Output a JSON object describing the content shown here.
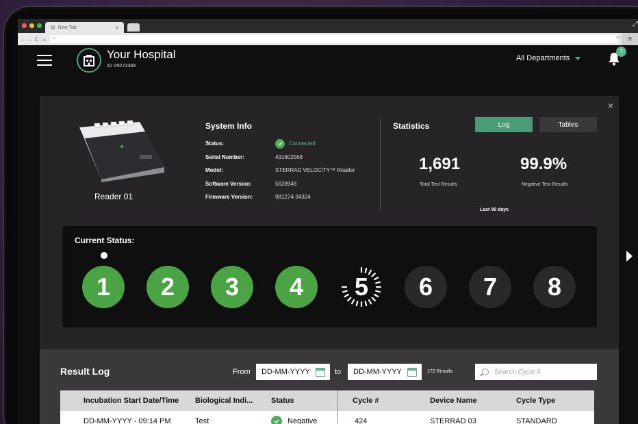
{
  "browser": {
    "tab_title": "New Tab",
    "tab_close": "×",
    "nav_glyphs": "← → C",
    "url_placeholder": "",
    "menu_glyph": "≡"
  },
  "header": {
    "hospital_name": "Your Hospital",
    "hospital_id": "ID: 09273389",
    "department": "All Departments",
    "notification_count": "7"
  },
  "panel": {
    "close_glyph": "×",
    "reader_name": "Reader 01",
    "system_info": {
      "title": "System Info",
      "rows": [
        {
          "key": "Status:",
          "value": "Connected",
          "status": true
        },
        {
          "key": "Serial Number:",
          "value": "431602568"
        },
        {
          "key": "Model:",
          "value": "STERRAD VELOCITY™ Reader"
        },
        {
          "key": "Software Version:",
          "value": "5628948"
        },
        {
          "key": "Firmware Version:",
          "value": "981274-34324"
        }
      ]
    },
    "statistics": {
      "title": "Statistics",
      "log_button": "Log",
      "tables_button": "Tables",
      "total_value": "1,691",
      "total_label": "Total Test Results",
      "negative_value": "99.9%",
      "negative_label": "Negative Test Results",
      "period": "Last 90 days"
    },
    "current_status": {
      "title": "Current Status:",
      "steps": [
        {
          "label": "1",
          "state": "done"
        },
        {
          "label": "2",
          "state": "done"
        },
        {
          "label": "3",
          "state": "done"
        },
        {
          "label": "4",
          "state": "done"
        },
        {
          "label": "5",
          "state": "active"
        },
        {
          "label": "6",
          "state": "todo"
        },
        {
          "label": "7",
          "state": "todo"
        },
        {
          "label": "8",
          "state": "todo"
        }
      ]
    }
  },
  "result_log": {
    "title": "Result Log",
    "from_label": "From",
    "from_value": "DD-MM-YYYY",
    "to_label": "to",
    "to_value": "DD-MM-YYYY",
    "results_count": "172 Results",
    "search_placeholder": "Search Cycle #",
    "columns": [
      "Incubation Start Date/Time",
      "Biological Indi...",
      "Status",
      "Cycle #",
      "Device Name",
      "Cycle Type"
    ],
    "rows": [
      [
        "DD-MM-YYYY -  09:14 PM",
        "Test",
        "Negative",
        "424",
        "STERRAD 03",
        "STANDARD"
      ]
    ]
  },
  "colors": {
    "accent_green": "#4aa443",
    "teal": "#4a9c78",
    "panel_bg": "#262427"
  }
}
